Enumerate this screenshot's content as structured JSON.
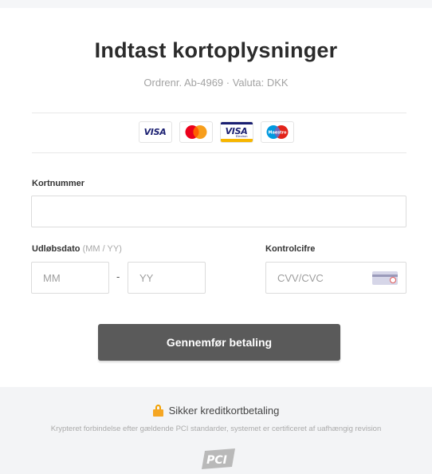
{
  "header": {
    "title": "Indtast kortoplysninger",
    "order_info": "Ordrenr. Ab-4969 · Valuta: DKK"
  },
  "card_brands": [
    {
      "name": "Visa",
      "icon": "visa-icon",
      "text": "VISA"
    },
    {
      "name": "Mastercard",
      "icon": "mastercard-icon",
      "text": ""
    },
    {
      "name": "Visa Electron",
      "icon": "visa-electron-icon",
      "text": "VISA"
    },
    {
      "name": "Maestro",
      "icon": "maestro-icon",
      "text": "Maestro"
    }
  ],
  "form": {
    "card_number": {
      "label": "Kortnummer",
      "value": "",
      "placeholder": ""
    },
    "expiry": {
      "label": "Udløbsdato",
      "hint": "(MM / YY)",
      "month_placeholder": "MM",
      "year_placeholder": "YY",
      "separator": "-"
    },
    "cvv": {
      "label": "Kontrolcifre",
      "placeholder": "CVV/CVC"
    }
  },
  "submit": {
    "label": "Gennemfør betaling"
  },
  "footer": {
    "secure_label": "Sikker kreditkortbetaling",
    "description": "Krypteret forbindelse efter gældende PCI standarder, systemet er certificeret af uafhængig revision",
    "pci_text": "PCI"
  },
  "colors": {
    "button": "#5a5a5a",
    "footer_bg": "#f3f4f6",
    "lock": "#f5a623",
    "visa_blue": "#1a1f71"
  }
}
